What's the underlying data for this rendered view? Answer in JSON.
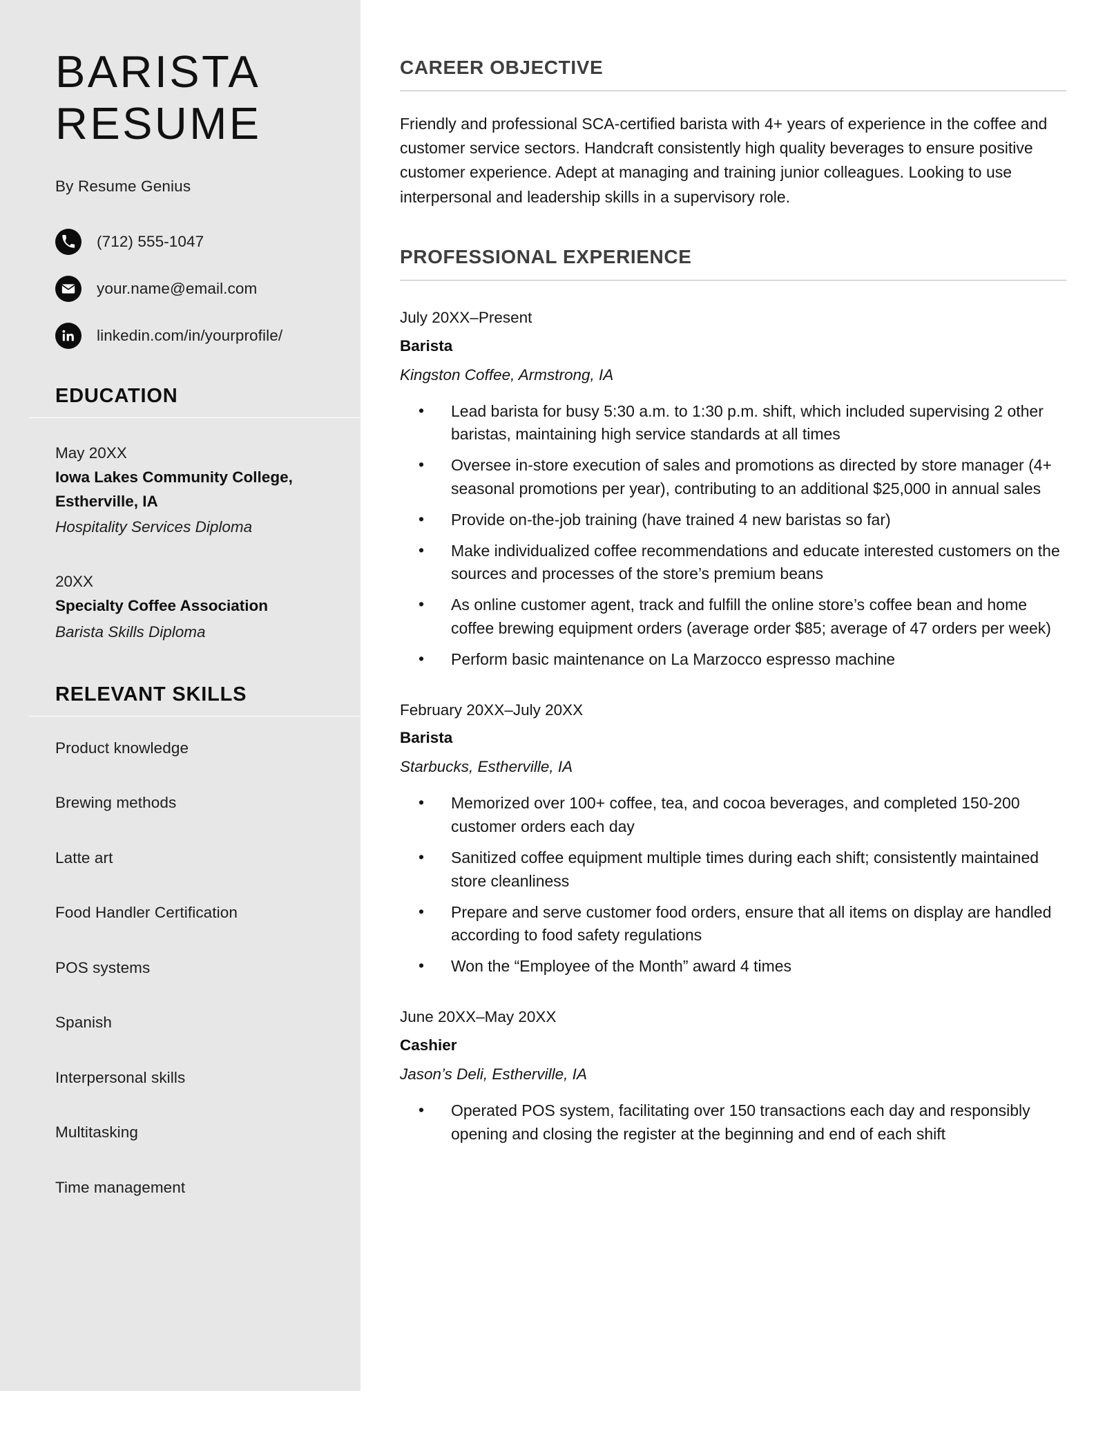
{
  "sidebar": {
    "title_line1": "BARISTA",
    "title_line2": "RESUME",
    "byline": "By Resume Genius",
    "contacts": [
      {
        "icon": "phone-icon",
        "text": "(712) 555-1047"
      },
      {
        "icon": "email-icon",
        "text": "your.name@email.com"
      },
      {
        "icon": "linkedin-icon",
        "text": "linkedin.com/in/yourprofile/"
      }
    ],
    "education": {
      "heading": "EDUCATION",
      "entries": [
        {
          "date": "May 20XX",
          "school_line1": "Iowa Lakes Community College,",
          "school_line2": "Estherville, IA",
          "degree": "Hospitality Services Diploma"
        },
        {
          "date": "20XX",
          "school_line1": "Specialty Coffee Association",
          "school_line2": "",
          "degree": "Barista Skills Diploma"
        }
      ]
    },
    "skills": {
      "heading": "RELEVANT SKILLS",
      "items": [
        "Product knowledge",
        "Brewing methods",
        "Latte art",
        "Food Handler Certification",
        "POS systems",
        "Spanish",
        "Interpersonal skills",
        "Multitasking",
        "Time management"
      ]
    }
  },
  "main": {
    "objective": {
      "heading": "CAREER OBJECTIVE",
      "text": "Friendly and professional SCA-certified barista with 4+ years of experience in the coffee and customer service sectors. Handcraft consistently high quality beverages to ensure positive customer experience. Adept at managing and training junior colleagues. Looking to use interpersonal and leadership skills in a supervisory role."
    },
    "experience": {
      "heading": "PROFESSIONAL EXPERIENCE",
      "jobs": [
        {
          "date": "July 20XX–Present",
          "title": "Barista",
          "company": "Kingston Coffee, Armstrong, IA",
          "bullets": [
            "Lead barista for busy 5:30 a.m. to 1:30 p.m. shift, which included supervising 2 other baristas, maintaining high service standards at all times",
            "Oversee in-store execution of sales and promotions as directed by store manager (4+ seasonal promotions per year), contributing to an additional $25,000 in annual sales",
            "Provide on-the-job training (have trained 4 new baristas so far)",
            "Make individualized coffee recommendations and educate interested customers on the sources and processes of the store’s premium beans",
            "As online customer agent, track and fulfill the online store’s coffee bean and home coffee brewing equipment orders (average order $85; average of 47 orders per week)",
            "Perform basic maintenance on La Marzocco espresso machine"
          ]
        },
        {
          "date": "February 20XX–July 20XX",
          "title": "Barista",
          "company": "Starbucks, Estherville, IA",
          "bullets": [
            "Memorized over 100+ coffee, tea, and cocoa beverages, and completed 150-200 customer orders each day",
            "Sanitized coffee equipment multiple times during each shift; consistently maintained store cleanliness",
            "Prepare and serve customer food orders, ensure that all items on display are handled according to food safety regulations",
            "Won the “Employee of the Month” award 4 times"
          ]
        },
        {
          "date": "June 20XX–May 20XX",
          "title": "Cashier",
          "company": "Jason’s Deli, Estherville, IA",
          "bullets": [
            "Operated POS system, facilitating over 150 transactions each day and responsibly opening and closing the register at the beginning and end of each shift"
          ]
        }
      ]
    }
  },
  "colors": {
    "sidebar_background": "#e7e7e7",
    "page_background": "#ffffff",
    "icon_background": "#0c0c0c",
    "main_heading": "#3e3e3e",
    "main_rule": "#b8b8b8",
    "sidebar_rule": "#ffffff"
  }
}
